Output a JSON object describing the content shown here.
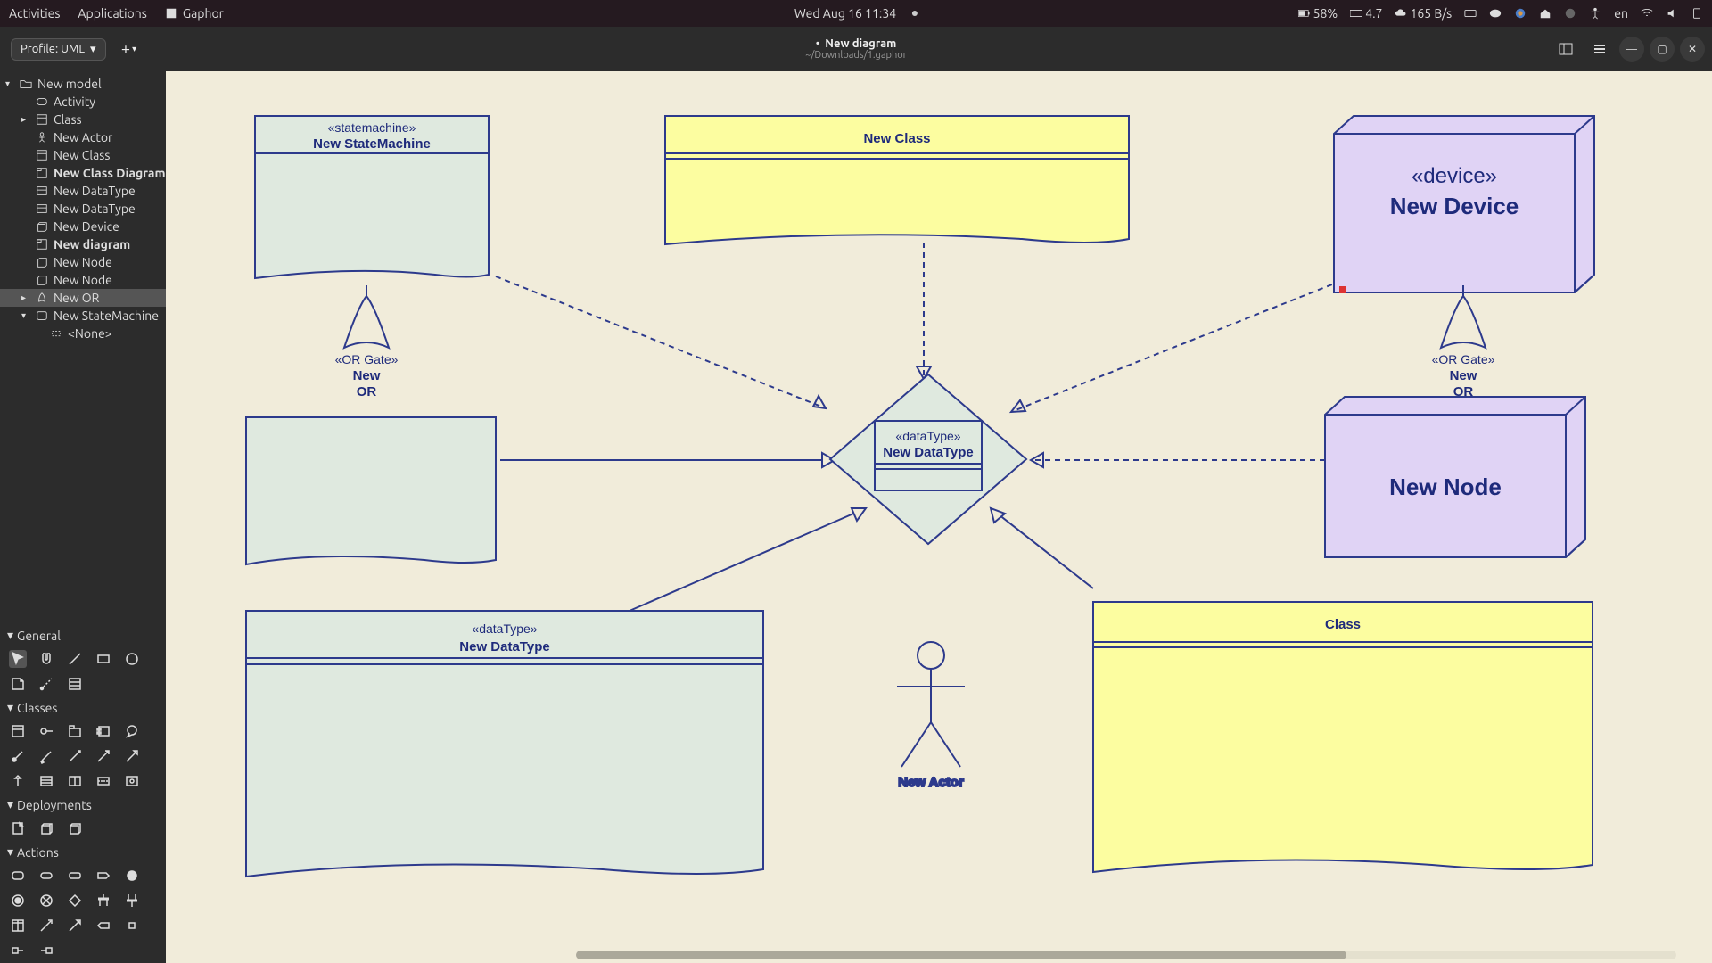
{
  "gnome": {
    "activities": "Activities",
    "applications": "Applications",
    "app_name": "Gaphor",
    "clock": "Wed Aug 16  11:34",
    "battery": "58%",
    "ram": "4.7",
    "net": "165 B/s",
    "lang": "en"
  },
  "titlebar": {
    "profile_label": "Profile: UML",
    "doc_title": "New diagram",
    "doc_path": "~/Downloads/1.gaphor"
  },
  "tree": {
    "root": "New model",
    "items": [
      {
        "label": "Activity"
      },
      {
        "label": "Class",
        "caret": true
      },
      {
        "label": "New Actor"
      },
      {
        "label": "New Class"
      },
      {
        "label": "New Class Diagram",
        "bold": true
      },
      {
        "label": "New DataType"
      },
      {
        "label": "New DataType"
      },
      {
        "label": "New Device"
      },
      {
        "label": "New diagram",
        "bold": true
      },
      {
        "label": "New Node"
      },
      {
        "label": "New Node"
      },
      {
        "label": "New OR",
        "caret": true,
        "selected": true
      },
      {
        "label": "New StateMachine",
        "caret": true,
        "open": true
      },
      {
        "label": "<None>",
        "child": true
      }
    ]
  },
  "palette": {
    "sections": [
      "General",
      "Classes",
      "Deployments",
      "Actions"
    ]
  },
  "diagram": {
    "statemachine": {
      "stereo": "«statemachine»",
      "name": "New StateMachine"
    },
    "newclass": {
      "name": "New Class"
    },
    "device": {
      "stereo": "«device»",
      "name": "New Device"
    },
    "or1": {
      "stereo": "«OR Gate»",
      "l1": "New",
      "l2": "OR"
    },
    "or2": {
      "stereo": "«OR Gate»",
      "l1": "New",
      "l2": "OR"
    },
    "datatype_center": {
      "stereo": "«dataType»",
      "name": "New DataType"
    },
    "node": {
      "name": "New Node"
    },
    "datatype_big": {
      "stereo": "«dataType»",
      "name": "New DataType"
    },
    "actor": {
      "name": "New Actor"
    },
    "class2": {
      "name": "Class"
    }
  }
}
